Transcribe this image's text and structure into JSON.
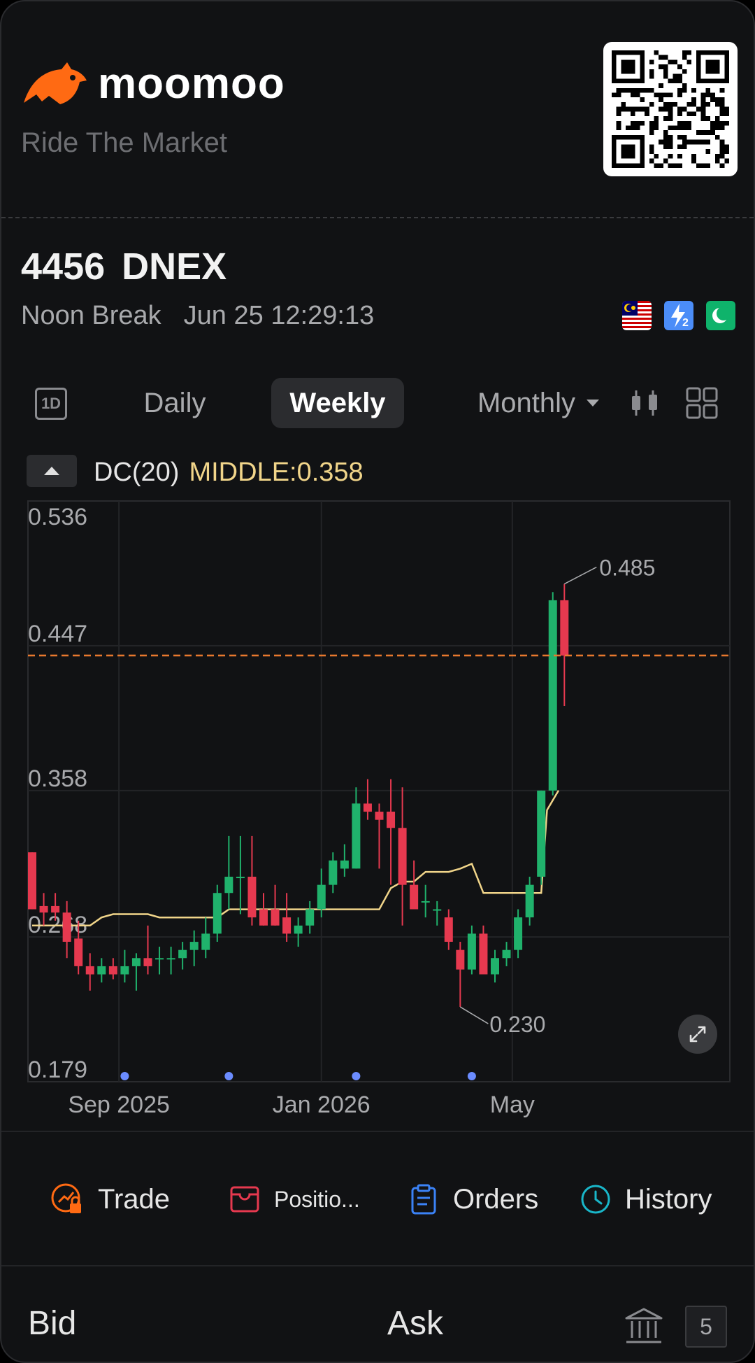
{
  "brand": {
    "name": "moomoo",
    "slogan": "Ride The Market",
    "color": "#ff6a13"
  },
  "stock": {
    "code": "4456",
    "name": "DNEX",
    "session": "Noon Break",
    "datetime": "Jun 25 12:29:13"
  },
  "badges": [
    "malaysia-flag-icon",
    "level2-icon",
    "shariah-icon"
  ],
  "tabs": {
    "intraday": "1D",
    "daily": "Daily",
    "weekly": "Weekly",
    "monthly": "Monthly",
    "selected": "Weekly"
  },
  "indicator": {
    "name": "DC(20)",
    "middle": "MIDDLE:0.358"
  },
  "chart_data": {
    "type": "candlestick",
    "ylim": [
      0.179,
      0.536
    ],
    "y_ticks": [
      "0.536",
      "0.447",
      "0.358",
      "0.268",
      "0.179"
    ],
    "x_labels": [
      {
        "label": "Sep 2025",
        "index": 7.5
      },
      {
        "label": "Jan 2026",
        "index": 25
      },
      {
        "label": "May",
        "index": 41.5
      }
    ],
    "last_price": 0.441,
    "annotations": {
      "high": "0.485",
      "low": "0.230"
    },
    "up_color": "#20b26c",
    "down_color": "#e6394f",
    "dc_middle_color": "#f1d58a",
    "price_line_color": "#e8792e",
    "candles": [
      [
        0.32,
        0.32,
        0.285,
        0.285
      ],
      [
        0.287,
        0.295,
        0.275,
        0.283
      ],
      [
        0.287,
        0.295,
        0.278,
        0.283
      ],
      [
        0.283,
        0.29,
        0.255,
        0.265
      ],
      [
        0.267,
        0.278,
        0.245,
        0.25
      ],
      [
        0.25,
        0.258,
        0.235,
        0.245
      ],
      [
        0.245,
        0.255,
        0.24,
        0.25
      ],
      [
        0.25,
        0.255,
        0.242,
        0.245
      ],
      [
        0.245,
        0.26,
        0.24,
        0.25
      ],
      [
        0.25,
        0.258,
        0.235,
        0.255
      ],
      [
        0.255,
        0.275,
        0.245,
        0.25
      ],
      [
        0.255,
        0.262,
        0.245,
        0.255
      ],
      [
        0.255,
        0.262,
        0.245,
        0.255
      ],
      [
        0.255,
        0.265,
        0.248,
        0.26
      ],
      [
        0.26,
        0.272,
        0.25,
        0.265
      ],
      [
        0.26,
        0.28,
        0.255,
        0.27
      ],
      [
        0.27,
        0.3,
        0.265,
        0.295
      ],
      [
        0.295,
        0.33,
        0.285,
        0.305
      ],
      [
        0.305,
        0.33,
        0.282,
        0.305
      ],
      [
        0.305,
        0.33,
        0.275,
        0.28
      ],
      [
        0.285,
        0.295,
        0.275,
        0.275
      ],
      [
        0.285,
        0.3,
        0.275,
        0.275
      ],
      [
        0.28,
        0.295,
        0.265,
        0.27
      ],
      [
        0.27,
        0.28,
        0.262,
        0.275
      ],
      [
        0.275,
        0.29,
        0.27,
        0.285
      ],
      [
        0.285,
        0.31,
        0.28,
        0.3
      ],
      [
        0.3,
        0.32,
        0.295,
        0.315
      ],
      [
        0.31,
        0.325,
        0.305,
        0.315
      ],
      [
        0.31,
        0.36,
        0.31,
        0.35
      ],
      [
        0.35,
        0.365,
        0.34,
        0.345
      ],
      [
        0.345,
        0.35,
        0.31,
        0.34
      ],
      [
        0.345,
        0.365,
        0.3,
        0.335
      ],
      [
        0.335,
        0.36,
        0.275,
        0.3
      ],
      [
        0.3,
        0.315,
        0.285,
        0.285
      ],
      [
        0.29,
        0.3,
        0.28,
        0.29
      ],
      [
        0.285,
        0.29,
        0.275,
        0.285
      ],
      [
        0.28,
        0.285,
        0.26,
        0.265
      ],
      [
        0.26,
        0.265,
        0.225,
        0.248
      ],
      [
        0.248,
        0.275,
        0.245,
        0.27
      ],
      [
        0.27,
        0.275,
        0.245,
        0.245
      ],
      [
        0.245,
        0.26,
        0.24,
        0.255
      ],
      [
        0.255,
        0.265,
        0.25,
        0.26
      ],
      [
        0.26,
        0.285,
        0.255,
        0.28
      ],
      [
        0.28,
        0.305,
        0.275,
        0.3
      ]
    ],
    "dc_middle": [
      0.275,
      0.275,
      0.275,
      0.275,
      0.275,
      0.275,
      0.28,
      0.282,
      0.282,
      0.282,
      0.282,
      0.28,
      0.28,
      0.28,
      0.28,
      0.28,
      0.28,
      0.285,
      0.285,
      0.285,
      0.285,
      0.285,
      0.285,
      0.285,
      0.285,
      0.285,
      0.285,
      0.285,
      0.285,
      0.285,
      0.285,
      0.298,
      0.302,
      0.302,
      0.308,
      0.308,
      0.308,
      0.31,
      0.313,
      0.295,
      0.295,
      0.295,
      0.295,
      0.295
    ]
  },
  "actions": {
    "trade": "Trade",
    "positions": "Positio...",
    "orders": "Orders",
    "history": "History"
  },
  "bottom": {
    "bid": "Bid",
    "ask": "Ask",
    "level": "5"
  }
}
